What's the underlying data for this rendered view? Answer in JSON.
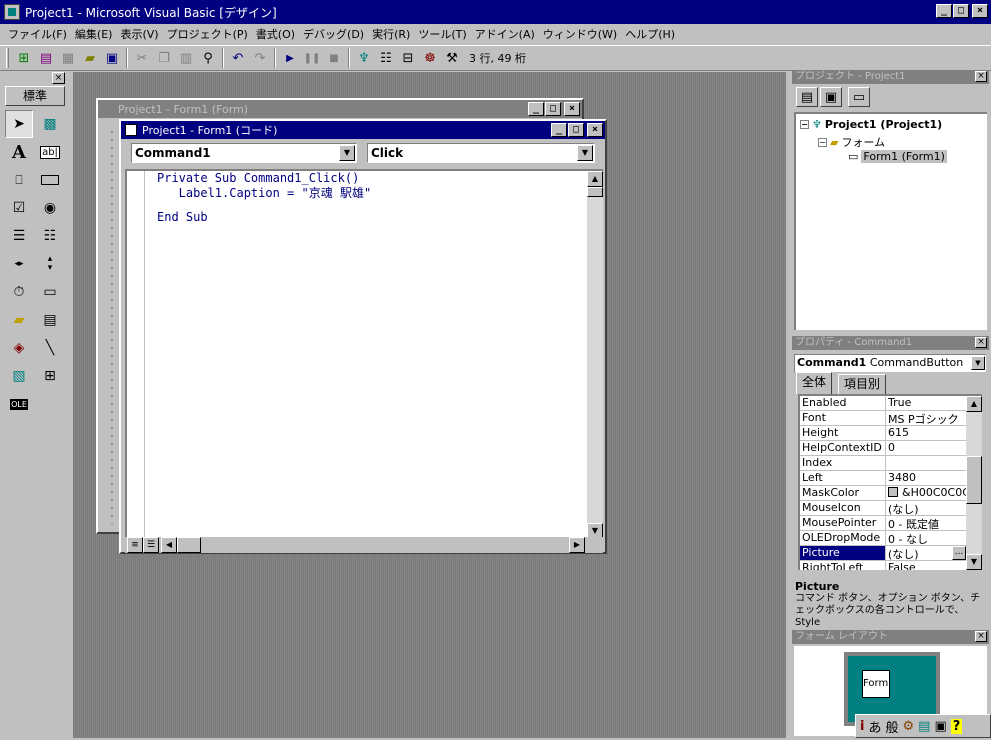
{
  "app": {
    "title": "Project1 - Microsoft Visual Basic [デザイン]"
  },
  "menu": [
    "ファイル(F)",
    "編集(E)",
    "表示(V)",
    "プロジェクト(P)",
    "書式(O)",
    "デバッグ(D)",
    "実行(R)",
    "ツール(T)",
    "アドイン(A)",
    "ウィンドウ(W)",
    "ヘルプ(H)"
  ],
  "toolbar": {
    "position": "3 行, 49 桁"
  },
  "toolbox": {
    "tab": "標準"
  },
  "form_window": {
    "title": "Project1 - Form1 (Form)"
  },
  "code_window": {
    "title": "Project1 - Form1 (コード)",
    "object_combo": "Command1",
    "proc_combo": "Click",
    "lines": [
      "Private Sub Command1_Click()",
      "   Label1.Caption = \"京魂 駅雄\"",
      "",
      "End Sub"
    ]
  },
  "project_panel": {
    "title": "プロジェクト - Project1",
    "root": "Project1 (Project1)",
    "folder": "フォーム",
    "form": "Form1 (Form1)"
  },
  "props_panel": {
    "title": "プロパティ - Command1",
    "object": "Command1",
    "object_type": "CommandButton",
    "tabs": [
      "全体",
      "項目別"
    ],
    "rows": [
      {
        "name": "Enabled",
        "value": "True"
      },
      {
        "name": "Font",
        "value": "MS Pゴシック"
      },
      {
        "name": "Height",
        "value": "615"
      },
      {
        "name": "HelpContextID",
        "value": "0"
      },
      {
        "name": "Index",
        "value": ""
      },
      {
        "name": "Left",
        "value": "3480"
      },
      {
        "name": "MaskColor",
        "value": "&H00C0C0C0"
      },
      {
        "name": "MouseIcon",
        "value": "(なし)"
      },
      {
        "name": "MousePointer",
        "value": "0 - 既定値"
      },
      {
        "name": "OLEDropMode",
        "value": "0 - なし"
      },
      {
        "name": "Picture",
        "value": "(なし)"
      },
      {
        "name": "RightToLeft",
        "value": "False"
      }
    ]
  },
  "description": {
    "title": "Picture",
    "text": "コマンド ボタン、オプション ボタン、チェックボックスの各コントロールで、Style"
  },
  "layout_panel": {
    "title": "フォーム レイアウト",
    "form_label": "Form"
  },
  "ime": [
    "あ",
    "般"
  ]
}
